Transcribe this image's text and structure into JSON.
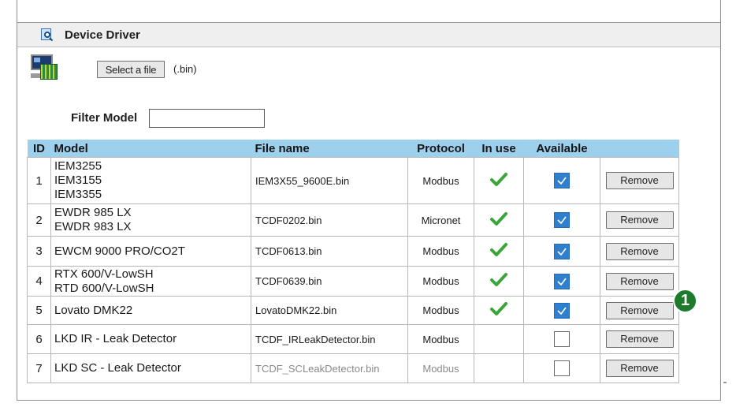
{
  "panel": {
    "title": "Device Driver",
    "icon": "search-document-icon"
  },
  "upload": {
    "device_icon": "device-board-icon",
    "select_label": "Select a file",
    "extension_hint": "(.bin)"
  },
  "filter": {
    "label": "Filter Model",
    "value": "",
    "placeholder": ""
  },
  "table": {
    "headers": {
      "id": "ID",
      "model": "Model",
      "file": "File name",
      "protocol": "Protocol",
      "in_use": "In use",
      "available": "Available",
      "action": ""
    },
    "rows": [
      {
        "id": "1",
        "model": [
          "IEM3255",
          "IEM3155",
          "IEM3355"
        ],
        "file": "IEM3X55_9600E.bin",
        "protocol": "Modbus",
        "in_use": true,
        "available": true,
        "action": "Remove",
        "muted": false
      },
      {
        "id": "2",
        "model": [
          "EWDR 985 LX",
          "EWDR 983 LX"
        ],
        "file": "TCDF0202.bin",
        "protocol": "Micronet",
        "in_use": true,
        "available": true,
        "action": "Remove",
        "muted": false
      },
      {
        "id": "3",
        "model": [
          "EWCM 9000 PRO/CO2T"
        ],
        "file": "TCDF0613.bin",
        "protocol": "Modbus",
        "in_use": true,
        "available": true,
        "action": "Remove",
        "muted": false
      },
      {
        "id": "4",
        "model": [
          "RTX 600/V-LowSH",
          "RTD 600/V-LowSH"
        ],
        "file": "TCDF0639.bin",
        "protocol": "Modbus",
        "in_use": true,
        "available": true,
        "action": "Remove",
        "muted": false
      },
      {
        "id": "5",
        "model": [
          "Lovato DMK22"
        ],
        "file": "LovatoDMK22.bin",
        "protocol": "Modbus",
        "in_use": true,
        "available": true,
        "action": "Remove",
        "muted": false
      },
      {
        "id": "6",
        "model": [
          "LKD IR - Leak Detector"
        ],
        "file": "TCDF_IRLeakDetector.bin",
        "protocol": "Modbus",
        "in_use": false,
        "available": false,
        "action": "Remove",
        "muted": false
      },
      {
        "id": "7",
        "model": [
          "LKD SC - Leak Detector"
        ],
        "file": "TCDF_SCLeakDetector.bin",
        "protocol": "Modbus",
        "in_use": false,
        "available": false,
        "action": "Remove",
        "muted": true
      }
    ]
  },
  "callout": {
    "number": "1"
  },
  "colors": {
    "header_bg": "#efefef",
    "table_header_bg": "#9dd0ec",
    "check_green": "#3aa63a",
    "checkbox_blue": "#2f7fd0",
    "callout_green": "#1e7a2c"
  }
}
